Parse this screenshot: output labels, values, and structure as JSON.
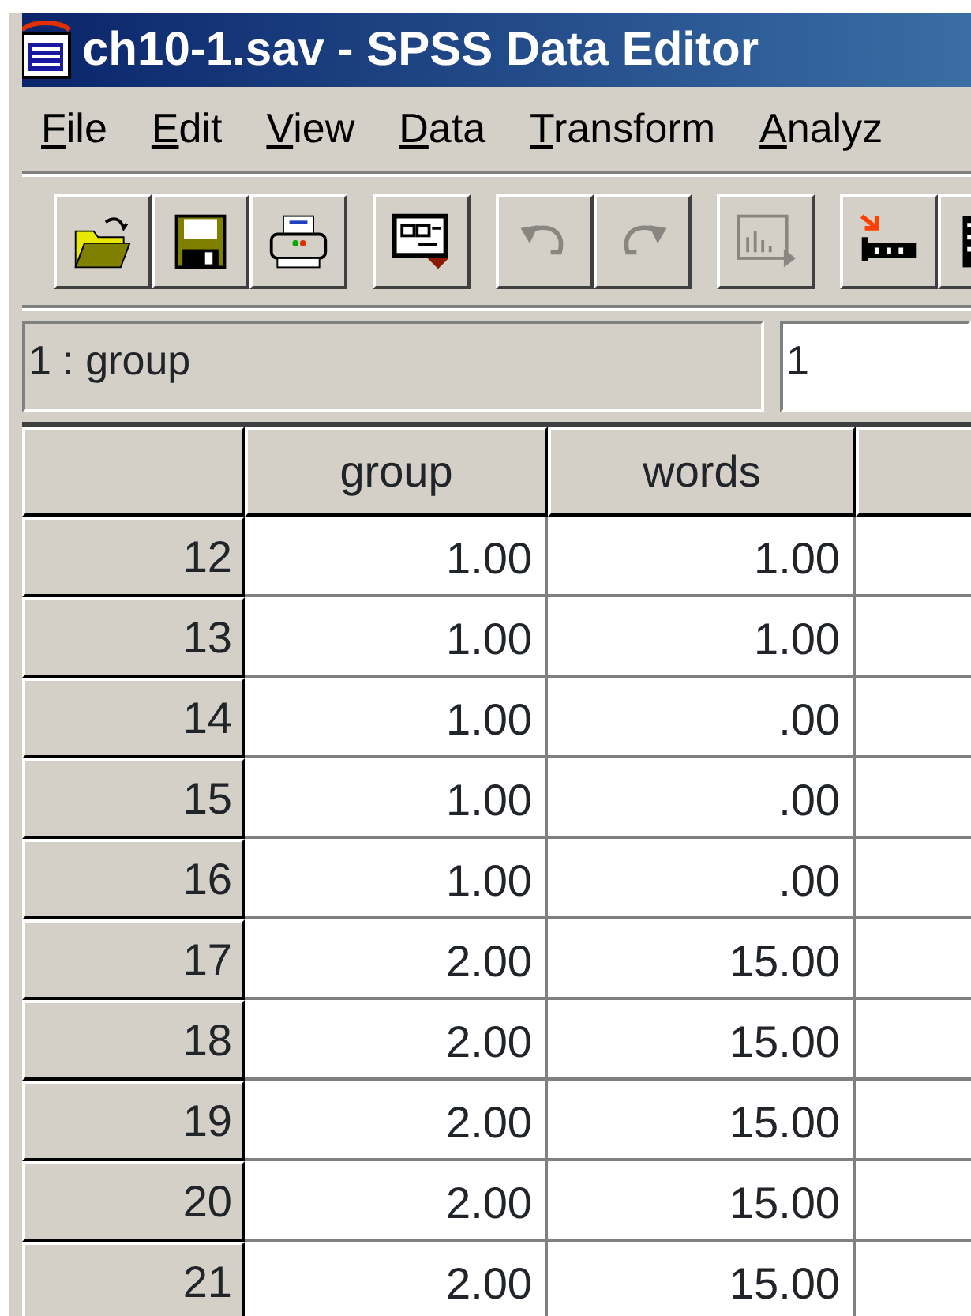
{
  "window": {
    "title": "ch10-1.sav - SPSS Data Editor"
  },
  "menu": [
    {
      "label": "File"
    },
    {
      "label": "Edit"
    },
    {
      "label": "View"
    },
    {
      "label": "Data"
    },
    {
      "label": "Transform"
    },
    {
      "label": "Analyz"
    }
  ],
  "toolbar": [
    {
      "kind": "open",
      "disabled": false
    },
    {
      "kind": "save",
      "disabled": false
    },
    {
      "kind": "print",
      "disabled": false
    },
    {
      "kind": "dialog",
      "disabled": false
    },
    {
      "kind": "undo",
      "disabled": true
    },
    {
      "kind": "redo",
      "disabled": true
    },
    {
      "kind": "chart",
      "disabled": true
    },
    {
      "kind": "insert-case",
      "disabled": false
    },
    {
      "kind": "insert-variable",
      "disabled": false
    }
  ],
  "cell_editor": {
    "cell": "1 : group",
    "value": "1"
  },
  "table": {
    "columns": [
      "group",
      "words"
    ],
    "rows": [
      {
        "case": "12",
        "cells": [
          "1.00",
          "1.00"
        ]
      },
      {
        "case": "13",
        "cells": [
          "1.00",
          "1.00"
        ]
      },
      {
        "case": "14",
        "cells": [
          "1.00",
          ".00"
        ]
      },
      {
        "case": "15",
        "cells": [
          "1.00",
          ".00"
        ]
      },
      {
        "case": "16",
        "cells": [
          "1.00",
          ".00"
        ]
      },
      {
        "case": "17",
        "cells": [
          "2.00",
          "15.00"
        ]
      },
      {
        "case": "18",
        "cells": [
          "2.00",
          "15.00"
        ]
      },
      {
        "case": "19",
        "cells": [
          "2.00",
          "15.00"
        ]
      },
      {
        "case": "20",
        "cells": [
          "2.00",
          "15.00"
        ]
      },
      {
        "case": "21",
        "cells": [
          "2.00",
          "15.00"
        ]
      }
    ]
  }
}
